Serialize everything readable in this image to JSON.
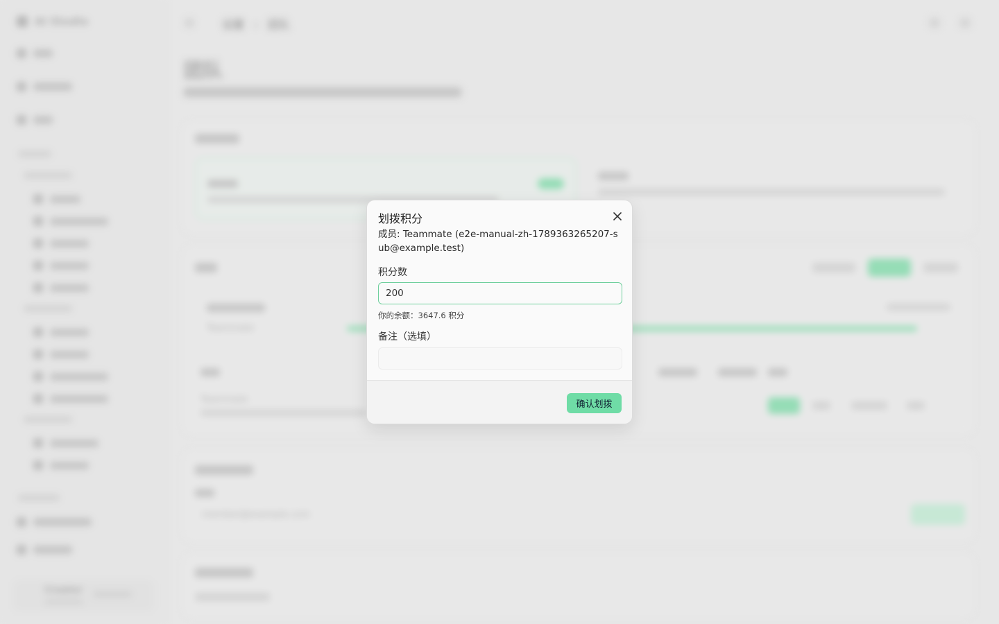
{
  "background": {
    "app_name": "AI Studio",
    "breadcrumb": [
      "设置",
      "团队"
    ],
    "page_title": "团队",
    "member_name": "Teammate",
    "invite_placeholder": "member@example.com",
    "user_name": "Creator"
  },
  "modal": {
    "title": "划拨积分",
    "member_text": "成员: Teammate (e2e-manual-zh-1789363265207-sub@example.test)",
    "points_label": "积分数",
    "points_value": "200",
    "balance_text": "你的余额：3647.6 积分",
    "note_label": "备注（选填）",
    "note_value": "",
    "confirm_label": "确认划拨"
  },
  "colors": {
    "accent": "#6fdca6",
    "focus_border": "#6fcf9c"
  }
}
